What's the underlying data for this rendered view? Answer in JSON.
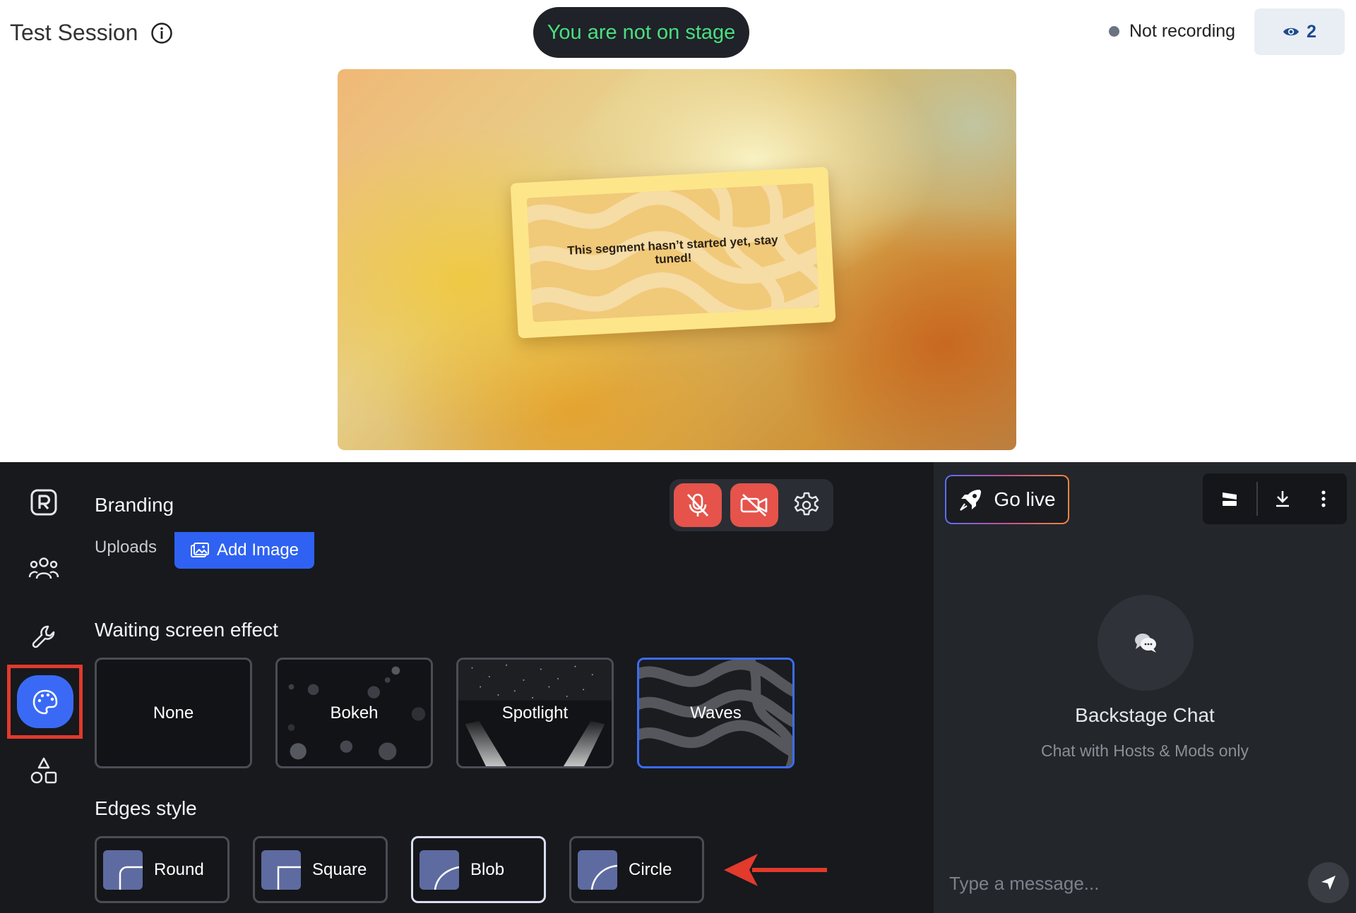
{
  "header": {
    "title": "Test Session",
    "stage_status": "You are not on stage",
    "recording_status": "Not recording",
    "viewer_count": "2"
  },
  "preview": {
    "message": "This segment hasn’t started yet, stay tuned!"
  },
  "sidebar": {
    "items": [
      {
        "icon": "logo-icon"
      },
      {
        "icon": "people-icon"
      },
      {
        "icon": "wrench-icon"
      },
      {
        "icon": "palette-icon",
        "active": true
      },
      {
        "icon": "shapes-icon"
      }
    ]
  },
  "branding": {
    "title": "Branding",
    "uploads_label": "Uploads",
    "add_image_label": "Add Image"
  },
  "waiting_effect": {
    "title": "Waiting screen effect",
    "options": [
      {
        "label": "None"
      },
      {
        "label": "Bokeh"
      },
      {
        "label": "Spotlight"
      },
      {
        "label": "Waves",
        "selected": true
      }
    ]
  },
  "edges": {
    "title": "Edges style",
    "options": [
      {
        "label": "Round"
      },
      {
        "label": "Square"
      },
      {
        "label": "Blob",
        "selected": true
      },
      {
        "label": "Circle"
      }
    ]
  },
  "chat": {
    "go_live_label": "Go live",
    "title": "Backstage Chat",
    "subtitle": "Chat with Hosts & Mods only",
    "input_placeholder": "Type a message..."
  },
  "colors": {
    "accent": "#3b6df6",
    "stage_text": "#4ade80",
    "muted_red": "#e5534b",
    "highlight_red": "#e23a2c"
  }
}
